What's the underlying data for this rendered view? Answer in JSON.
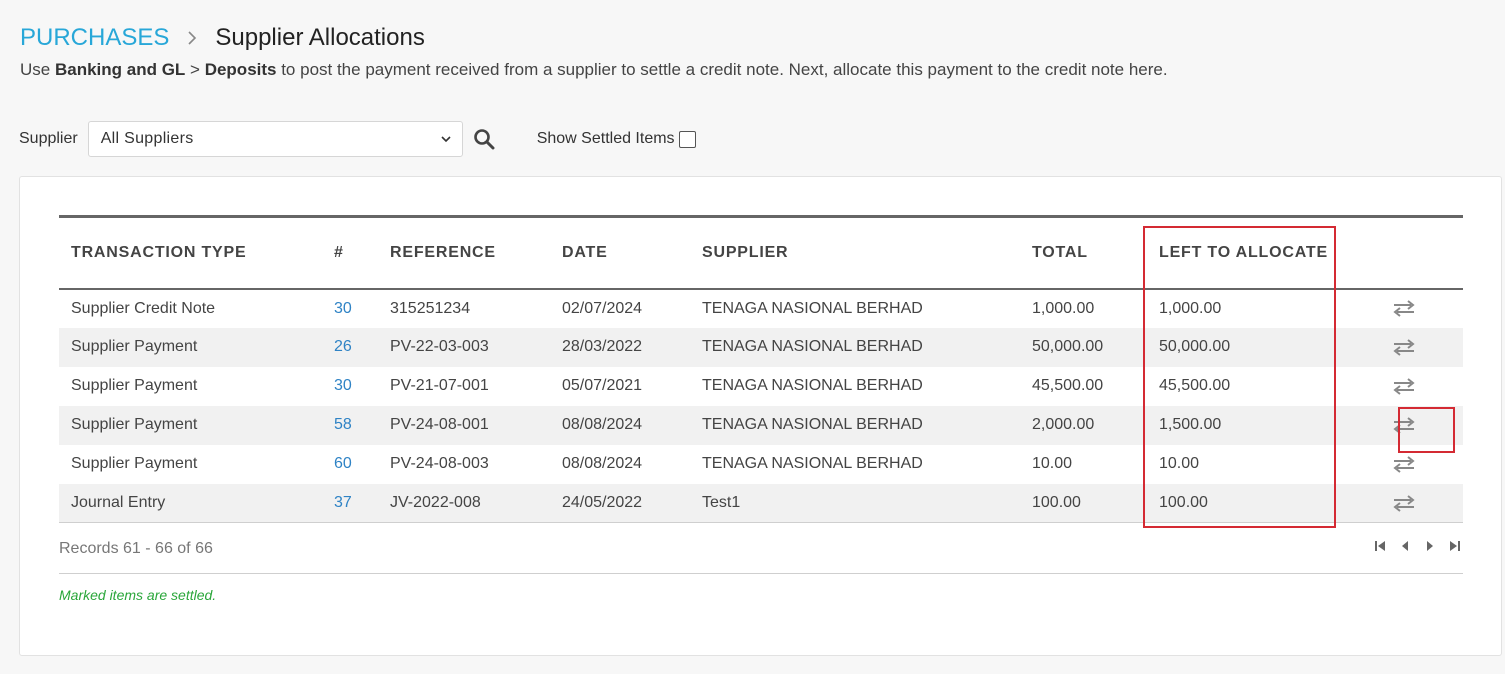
{
  "breadcrumb": {
    "section": "PURCHASES",
    "current": "Supplier Allocations"
  },
  "intro": {
    "prefix": "Use ",
    "bold1": "Banking and GL",
    "sep": " > ",
    "bold2": "Deposits",
    "suffix": " to post the payment received from a supplier to settle a credit note. Next, allocate this payment to the credit note here."
  },
  "filters": {
    "supplier_label": "Supplier",
    "supplier_selected": "All Suppliers",
    "show_settled_label": "Show Settled Items",
    "show_settled_checked": false
  },
  "table": {
    "columns": [
      "TRANSACTION TYPE",
      "#",
      "REFERENCE",
      "DATE",
      "SUPPLIER",
      "TOTAL",
      "LEFT TO ALLOCATE",
      ""
    ],
    "rows": [
      {
        "type": "Supplier Credit Note",
        "num": "30",
        "reference": "315251234",
        "date": "02/07/2024",
        "supplier": "TENAGA NASIONAL BERHAD",
        "total": "1,000.00",
        "left": "1,000.00"
      },
      {
        "type": "Supplier Payment",
        "num": "26",
        "reference": "PV-22-03-003",
        "date": "28/03/2022",
        "supplier": "TENAGA NASIONAL BERHAD",
        "total": "50,000.00",
        "left": "50,000.00"
      },
      {
        "type": "Supplier Payment",
        "num": "30",
        "reference": "PV-21-07-001",
        "date": "05/07/2021",
        "supplier": "TENAGA NASIONAL BERHAD",
        "total": "45,500.00",
        "left": "45,500.00"
      },
      {
        "type": "Supplier Payment",
        "num": "58",
        "reference": "PV-24-08-001",
        "date": "08/08/2024",
        "supplier": "TENAGA NASIONAL BERHAD",
        "total": "2,000.00",
        "left": "1,500.00"
      },
      {
        "type": "Supplier Payment",
        "num": "60",
        "reference": "PV-24-08-003",
        "date": "08/08/2024",
        "supplier": "TENAGA NASIONAL BERHAD",
        "total": "10.00",
        "left": "10.00"
      },
      {
        "type": "Journal Entry",
        "num": "37",
        "reference": "JV-2022-008",
        "date": "24/05/2022",
        "supplier": "Test1",
        "total": "100.00",
        "left": "100.00"
      }
    ]
  },
  "footer": {
    "records": "Records 61 - 66 of 66",
    "note": "Marked items are settled."
  },
  "icons": {
    "breadcrumb_sep": "chevron-right-icon",
    "select_caret": "chevron-down-icon",
    "search": "search-icon",
    "allocate": "swap-arrows-icon",
    "pager": [
      "first-page-icon",
      "prev-page-icon",
      "next-page-icon",
      "last-page-icon"
    ]
  },
  "colors": {
    "accent": "#28a7d8",
    "link": "#2f83c5",
    "highlight": "#d42a33",
    "note": "#2aa63a"
  }
}
